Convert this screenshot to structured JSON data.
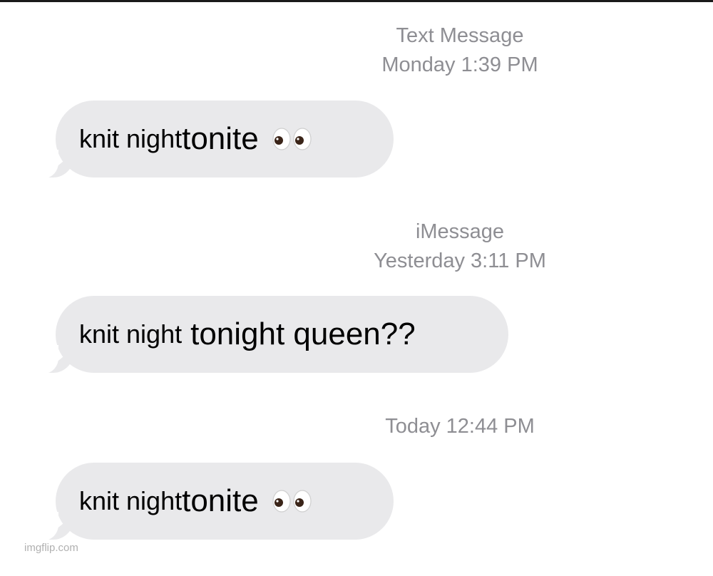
{
  "thread": [
    {
      "meta": [
        "Text Message",
        "Monday 1:39 PM"
      ],
      "message": {
        "part_a": "knit night",
        "part_b": "tonite",
        "emoji": "eyes-emoji"
      }
    },
    {
      "meta": [
        "iMessage",
        "Yesterday 3:11 PM"
      ],
      "message": {
        "part_a": "knit night",
        "part_b": "tonight queen??",
        "emoji": ""
      }
    },
    {
      "meta": [
        "Today 12:44 PM"
      ],
      "message": {
        "part_a": "knit night",
        "part_b": "tonite",
        "emoji": "eyes-emoji"
      }
    }
  ],
  "watermark": "imgflip.com",
  "colors": {
    "bubble": "#e9e9eb",
    "timestamp": "#8e8e93",
    "text": "#000000"
  }
}
